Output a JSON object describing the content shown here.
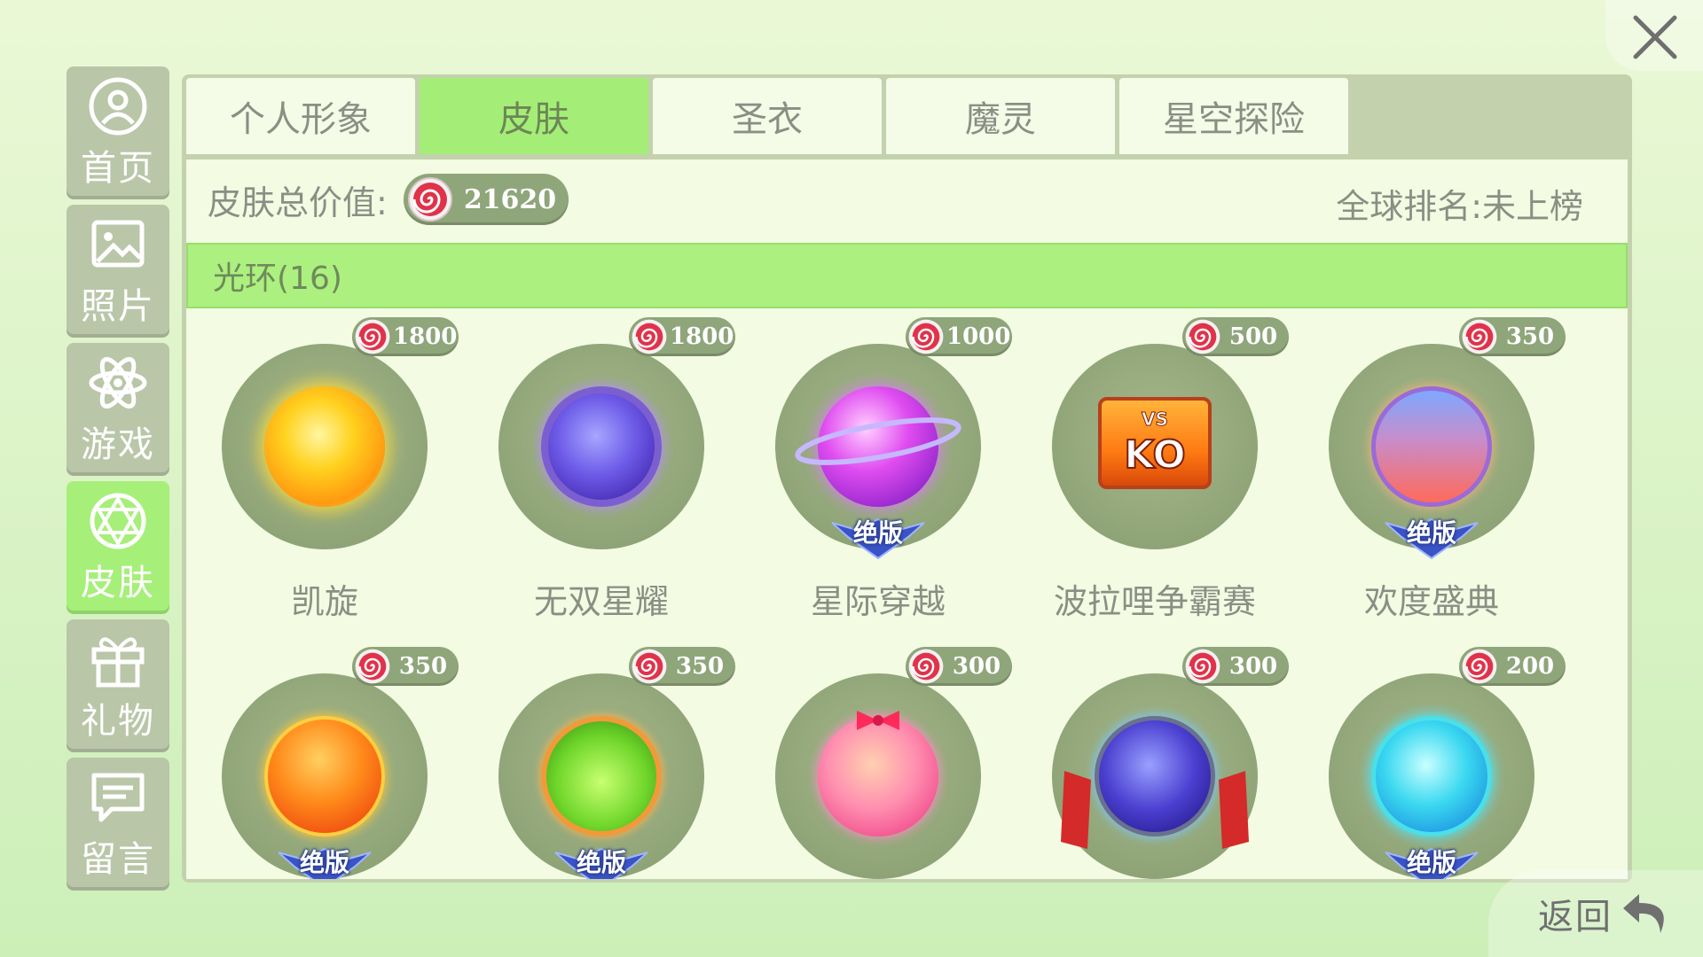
{
  "nav": {
    "items": [
      {
        "label": "首页",
        "icon": "profile-icon",
        "active": false
      },
      {
        "label": "照片",
        "icon": "photo-icon",
        "active": false
      },
      {
        "label": "游戏",
        "icon": "atom-icon",
        "active": false
      },
      {
        "label": "皮肤",
        "icon": "skin-icon",
        "active": true
      },
      {
        "label": "礼物",
        "icon": "gift-icon",
        "active": false
      },
      {
        "label": "留言",
        "icon": "message-icon",
        "active": false
      }
    ]
  },
  "tabs": [
    {
      "label": "个人形象",
      "active": false
    },
    {
      "label": "皮肤",
      "active": true
    },
    {
      "label": "圣衣",
      "active": false
    },
    {
      "label": "魔灵",
      "active": false
    },
    {
      "label": "星空探险",
      "active": false
    }
  ],
  "summary": {
    "total_label": "皮肤总价值:",
    "total_value": "21620",
    "rank_text": "全球排名:未上榜"
  },
  "category": {
    "label": "光环(16)"
  },
  "items": [
    {
      "name": "凯旋",
      "price": "1800",
      "badge": "",
      "orb": "sun"
    },
    {
      "name": "无双星耀",
      "price": "1800",
      "badge": "",
      "orb": "crown"
    },
    {
      "name": "星际穿越",
      "price": "1000",
      "badge": "绝版",
      "orb": "planet"
    },
    {
      "name": "波拉哩争霸赛",
      "price": "500",
      "badge": "",
      "orb": "ko"
    },
    {
      "name": "欢度盛典",
      "price": "350",
      "badge": "绝版",
      "orb": "festival"
    },
    {
      "name": "",
      "price": "350",
      "badge": "绝版",
      "orb": "star"
    },
    {
      "name": "",
      "price": "350",
      "badge": "绝版",
      "orb": "forest"
    },
    {
      "name": "",
      "price": "300",
      "badge": "",
      "orb": "bow"
    },
    {
      "name": "",
      "price": "300",
      "badge": "",
      "orb": "hero"
    },
    {
      "name": "",
      "price": "200",
      "badge": "绝版",
      "orb": "aqua"
    }
  ],
  "back": {
    "label": "返回"
  },
  "colors": {
    "accent_green": "#a6ef79",
    "nav_bg": "#b9c6a8",
    "pill_bg": "#8fa57a",
    "coin_red": "#e0334a",
    "text_grey": "#8a8f84"
  }
}
